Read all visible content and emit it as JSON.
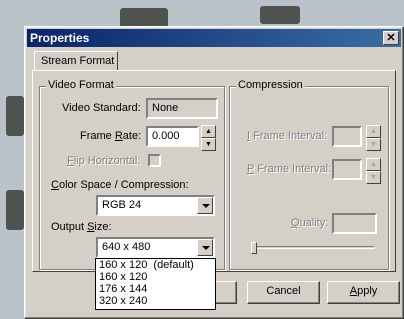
{
  "window": {
    "title": "Properties"
  },
  "tabs": [
    {
      "label": "Stream Format"
    }
  ],
  "video_format": {
    "group_label": "Video Format",
    "video_standard_label": "Video Standard:",
    "video_standard_value": "None",
    "frame_rate_label_pre": "Frame ",
    "frame_rate_label_u": "R",
    "frame_rate_label_post": "ate:",
    "frame_rate_value": "0.000",
    "flip_label_u": "F",
    "flip_label_post": "lip Horizontal:",
    "color_space_label_u": "C",
    "color_space_label_post": "olor Space / Compression:",
    "color_space_value": "RGB 24",
    "output_size_label_pre": "Output ",
    "output_size_label_u": "S",
    "output_size_label_post": "ize:",
    "output_size_value": "640 x 480",
    "output_size_options": [
      "160 x 120  (default)",
      "160 x 120",
      "176 x 144",
      "320 x 240"
    ]
  },
  "compression": {
    "group_label": "Compression",
    "i_frame_label_u": "I",
    "i_frame_label_post": " Frame Interval:",
    "p_frame_label_u": "P",
    "p_frame_label_post": " Frame Interval:",
    "quality_label_u": "Q",
    "quality_label_post": "uality:"
  },
  "buttons": {
    "cancel": "Cancel",
    "apply_u": "A",
    "apply_post": "pply"
  },
  "icons": {
    "close": "close-icon",
    "spin_up": "spin-up-icon",
    "spin_down": "spin-down-icon",
    "dropdown": "chevron-down-icon"
  }
}
